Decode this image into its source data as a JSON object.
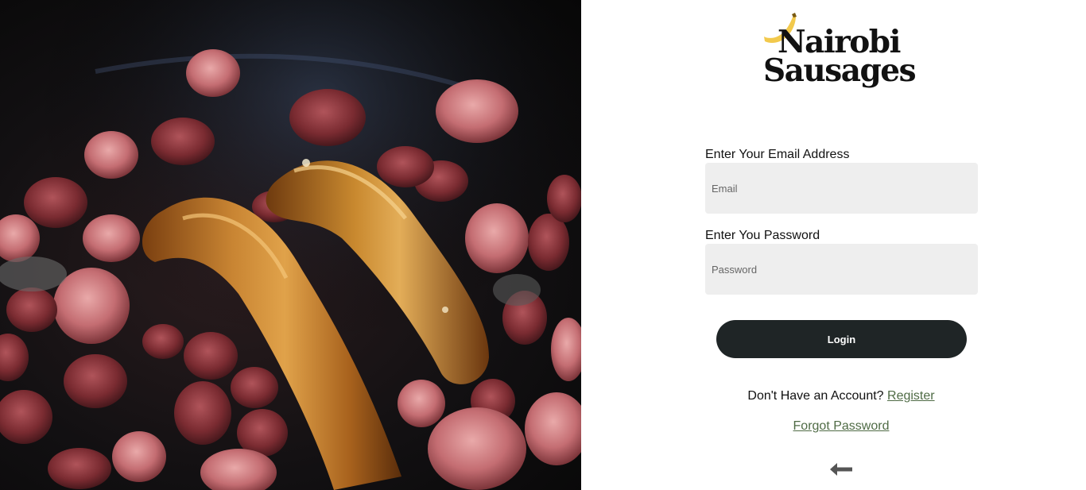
{
  "brand": {
    "line1": "Nairobi",
    "line2": "Sausages",
    "icon": "banana-icon",
    "accent_color": "#f2c94c"
  },
  "login_form": {
    "email_label": "Enter Your Email Address",
    "email_placeholder": "Email",
    "email_value": "",
    "password_label": "Enter You Password",
    "password_placeholder": "Password",
    "password_value": "",
    "login_label": "Login"
  },
  "footer_links": {
    "no_account_text": "Don't Have an Account?",
    "register_label": "Register",
    "forgot_label": "Forgot Password",
    "back_icon": "arrow-left-icon"
  },
  "colors": {
    "button_bg": "#1f2526",
    "link": "#4f6b45",
    "input_bg": "#eeeeee"
  }
}
